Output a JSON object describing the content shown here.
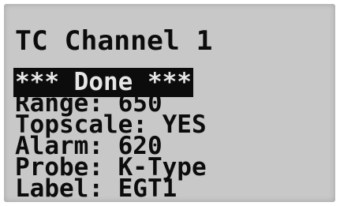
{
  "display": {
    "title": "TC Channel 1",
    "status": "*** Done ***",
    "lines": [
      "Range: 650",
      "Topscale: YES",
      "Alarm: 620",
      "Probe: K-Type",
      "Label: EGT1"
    ],
    "colors": {
      "lcd_background": "#c8c8c8",
      "text": "#0c0c0c",
      "highlight_text": "#e6e6e6"
    }
  }
}
